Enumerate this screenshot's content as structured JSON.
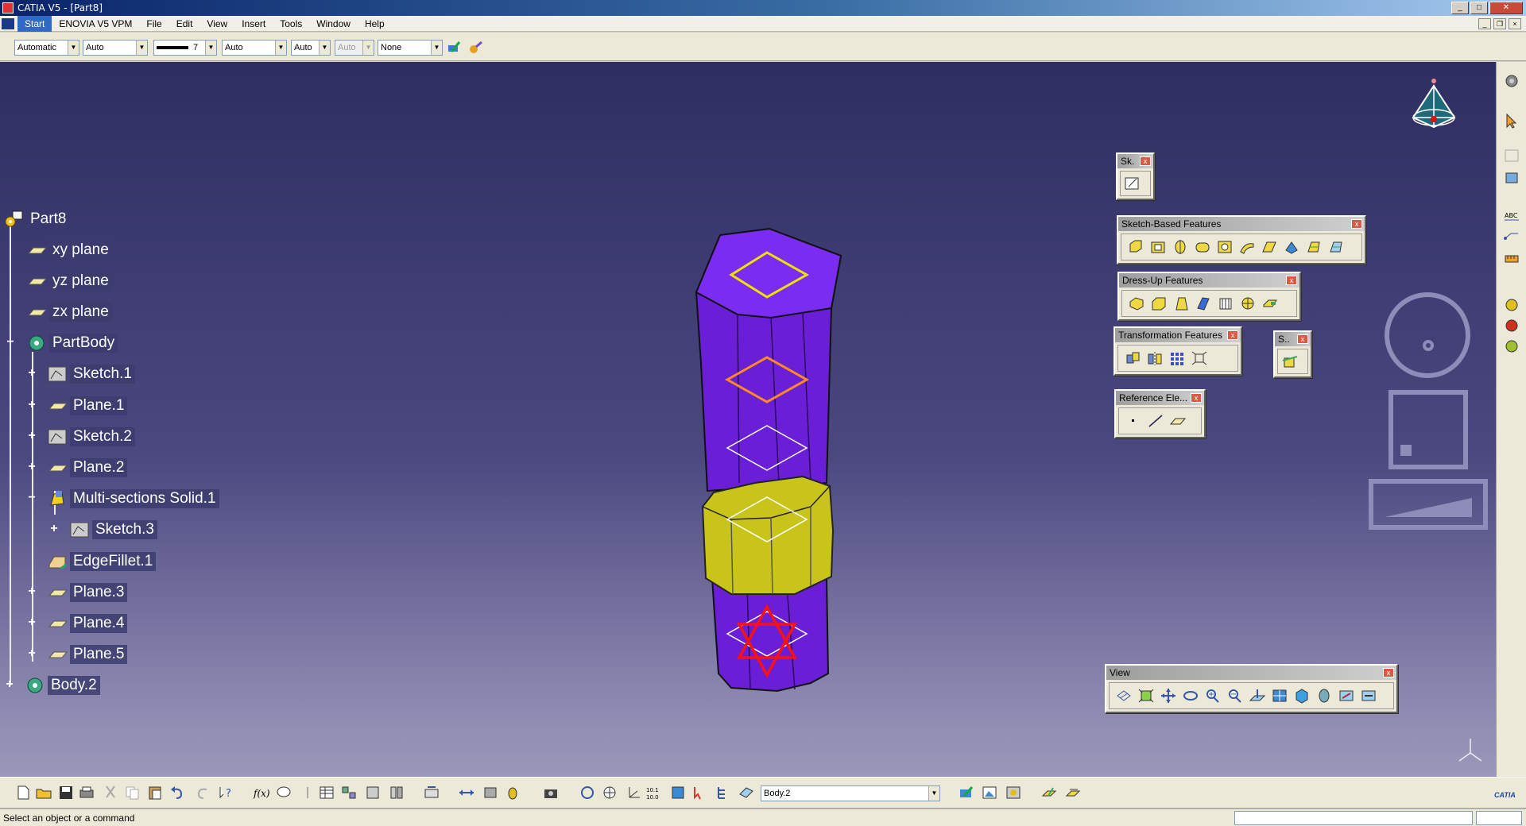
{
  "window": {
    "title": "CATIA V5 - [Part8]"
  },
  "menu": {
    "items": [
      "Start",
      "ENOVIA V5 VPM",
      "File",
      "Edit",
      "View",
      "Insert",
      "Tools",
      "Window",
      "Help"
    ]
  },
  "properties_toolbar": {
    "color": "Automatic",
    "transparency": "Auto",
    "line_thickness": "7",
    "line_type": "Auto",
    "point_symbol": "Auto",
    "layer_disabled": "Auto",
    "rendering": "None"
  },
  "tree": {
    "root": "Part8",
    "nodes": [
      {
        "label": "xy plane",
        "icon": "plane-icon"
      },
      {
        "label": "yz plane",
        "icon": "plane-icon"
      },
      {
        "label": "zx plane",
        "icon": "plane-icon"
      },
      {
        "label": "PartBody",
        "icon": "body-icon"
      },
      {
        "label": "Sketch.1",
        "icon": "sketch-icon"
      },
      {
        "label": "Plane.1",
        "icon": "plane-icon"
      },
      {
        "label": "Sketch.2",
        "icon": "sketch-icon"
      },
      {
        "label": "Plane.2",
        "icon": "plane-icon"
      },
      {
        "label": "Multi-sections Solid.1",
        "icon": "multi-section-solid-icon"
      },
      {
        "label": "Sketch.3",
        "icon": "sketch-icon"
      },
      {
        "label": "EdgeFillet.1",
        "icon": "edge-fillet-icon"
      },
      {
        "label": "Plane.3",
        "icon": "plane-icon"
      },
      {
        "label": "Plane.4",
        "icon": "plane-icon"
      },
      {
        "label": "Plane.5",
        "icon": "plane-icon"
      },
      {
        "label": "Body.2",
        "icon": "body-icon"
      }
    ]
  },
  "floating_toolbars": {
    "sketcher": "Sk.",
    "sketch_based": "Sketch-Based Features",
    "dress_up": "Dress-Up Features",
    "transformation": "Transformation Features",
    "surface": "S..",
    "reference": "Reference Ele...",
    "view": "View"
  },
  "bottom_toolbar": {
    "current_body": "Body.2"
  },
  "status": {
    "message": "Select an object or a command"
  },
  "colors": {
    "solid": "#6a1fd6",
    "ring": "#c9c41a",
    "viewport_top": "#2e2e62",
    "viewport_bottom": "#9c98bb"
  }
}
